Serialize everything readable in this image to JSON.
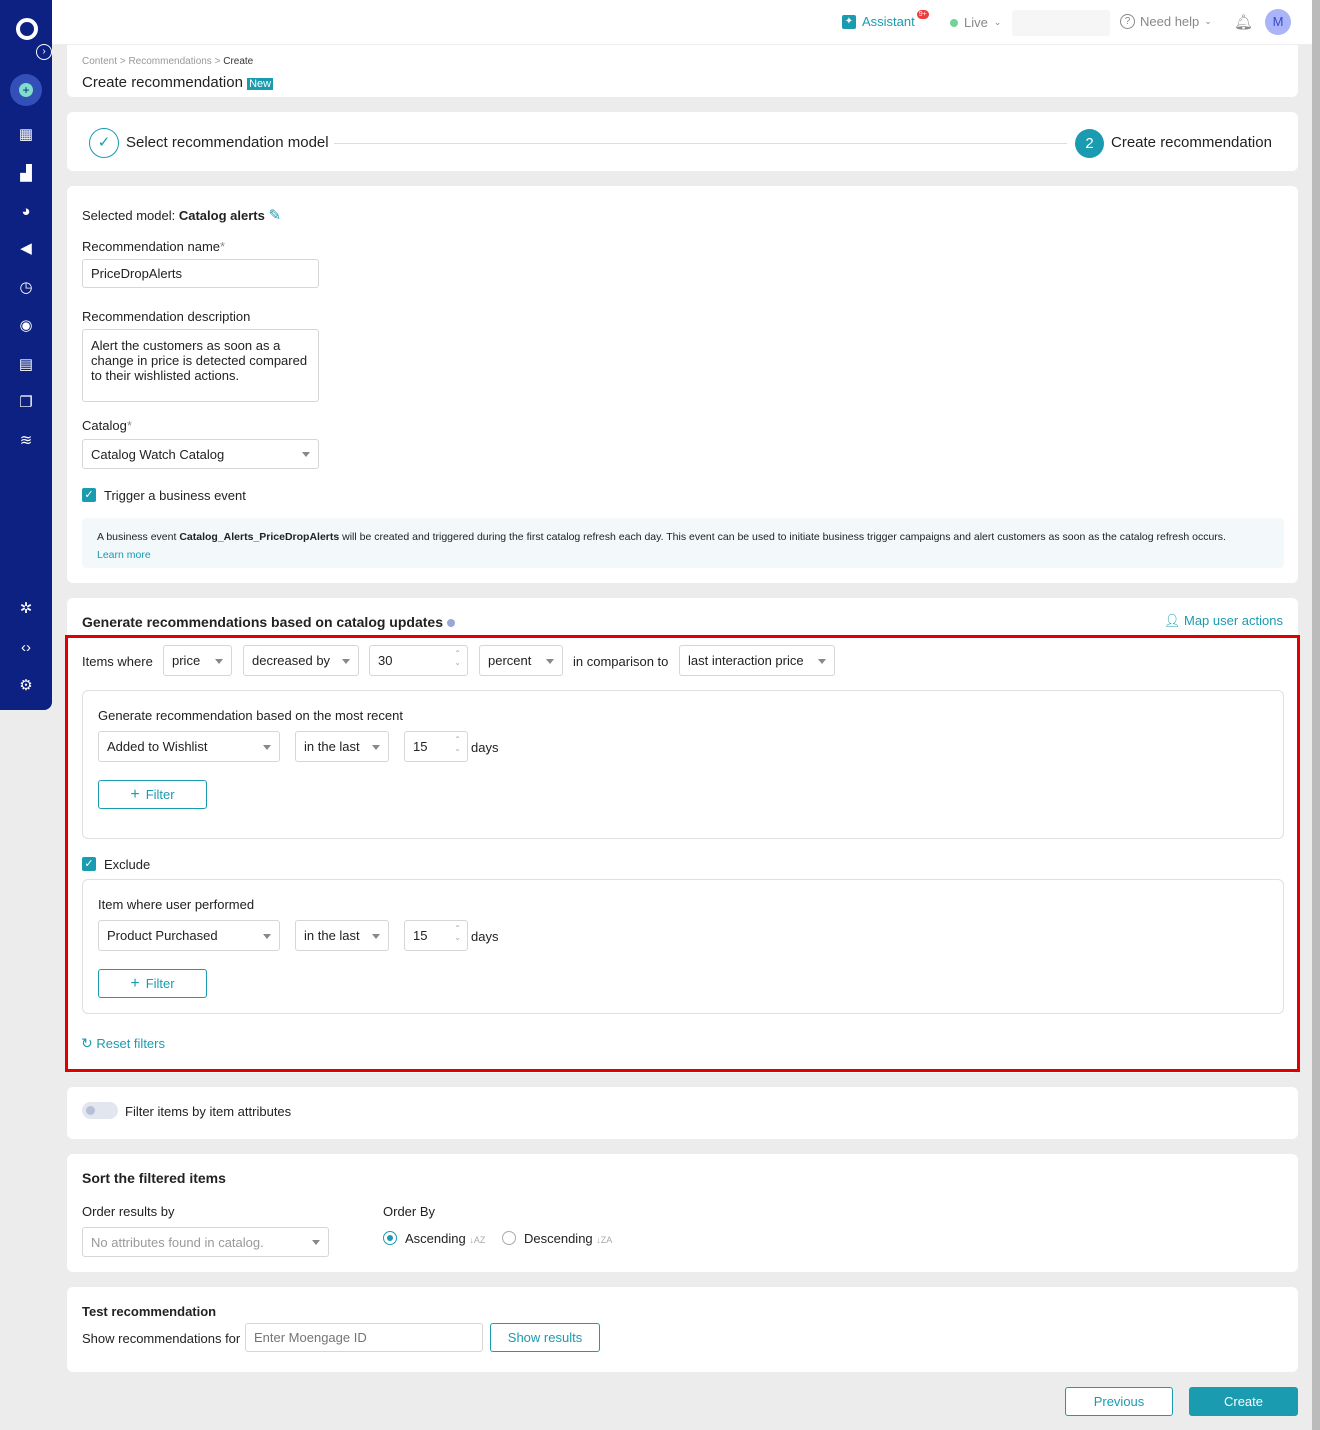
{
  "topbar": {
    "assistant": "Assistant",
    "assistant_badge": "9+",
    "env": "Live",
    "help": "Need help",
    "avatar": "M"
  },
  "breadcrumb": [
    "Content",
    "Recommendations",
    "Create"
  ],
  "page_title": "Create recommendation",
  "new_badge": "New",
  "steps": [
    {
      "label": "Select recommendation model",
      "done": true
    },
    {
      "num": "2",
      "label": "Create recommendation"
    }
  ],
  "model": {
    "label": "Selected model:",
    "value": "Catalog alerts"
  },
  "name": {
    "label": "Recommendation name",
    "value": "PriceDropAlerts"
  },
  "desc": {
    "label": "Recommendation description",
    "value": "Alert the customers as soon as a change in price is detected compared to their wishlisted actions."
  },
  "catalog": {
    "label": "Catalog",
    "value": "Catalog Watch Catalog"
  },
  "trigger": {
    "label": "Trigger a business event",
    "checked": true
  },
  "info": {
    "pre": "A business event ",
    "event": "Catalog_Alerts_PriceDropAlerts",
    "post": " will be created and triggered during the first catalog refresh each day. This event can be used to initiate business trigger campaigns and alert customers as soon as the catalog refresh occurs.",
    "link": "Learn more"
  },
  "gen": {
    "title": "Generate recommendations based on catalog updates",
    "map": "Map user actions",
    "items_where": "Items where",
    "attr": "price",
    "op": "decreased by",
    "amount": "30",
    "unit": "percent",
    "cmp": "in comparison to",
    "cmp_val": "last interaction price",
    "recent_label": "Generate recommendation based on the most recent",
    "recent_action": "Added to Wishlist",
    "recent_time": "in the last",
    "recent_days": "15",
    "days": "days",
    "filter": "Filter",
    "exclude": "Exclude",
    "ex_label": "Item where user performed",
    "ex_action": "Product Purchased",
    "ex_time": "in the last",
    "ex_days": "15",
    "reset": "Reset filters"
  },
  "attr_filter": {
    "label": "Filter items by item attributes",
    "on": false
  },
  "sort": {
    "title": "Sort the filtered items",
    "order_label": "Order results by",
    "order_placeholder": "No attributes found in catalog.",
    "by_label": "Order By",
    "asc": "Ascending",
    "desc": "Descending",
    "selected": "Ascending"
  },
  "test": {
    "title": "Test recommendation",
    "label": "Show recommendations for",
    "placeholder": "Enter Moengage ID",
    "button": "Show results"
  },
  "footer": {
    "prev": "Previous",
    "create": "Create"
  },
  "colors": {
    "accent": "#1a9bb0",
    "sidebar": "#0c2182",
    "highlight": "#e00000"
  }
}
